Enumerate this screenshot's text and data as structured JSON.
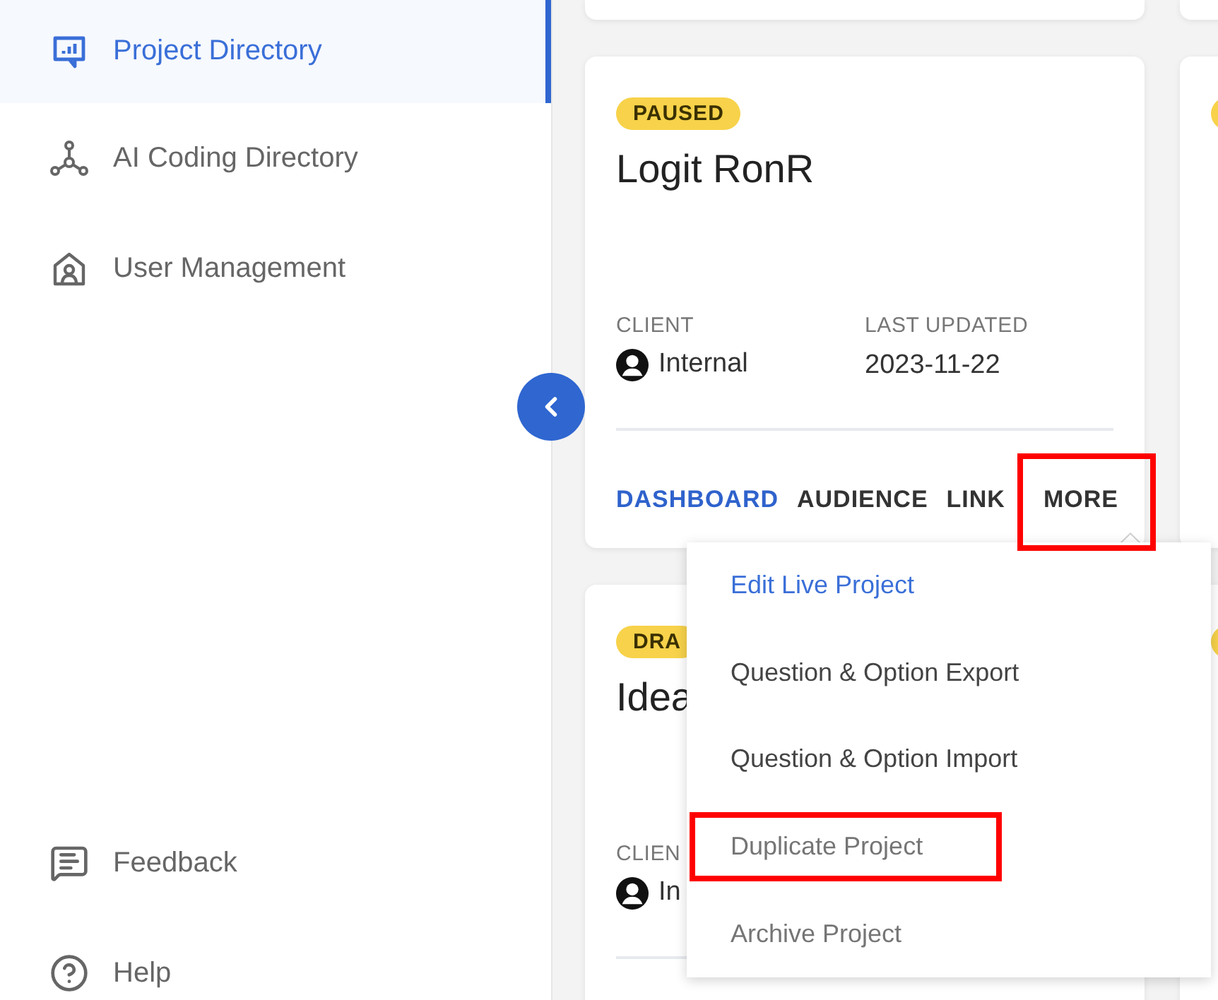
{
  "sidebar": {
    "items": [
      {
        "label": "Project Directory",
        "selected": true
      },
      {
        "label": "AI Coding Directory",
        "selected": false
      },
      {
        "label": "User Management",
        "selected": false
      }
    ],
    "footer_items": [
      {
        "label": "Feedback"
      },
      {
        "label": "Help"
      }
    ]
  },
  "cards": [
    {
      "status": "PAUSED",
      "title": "Logit RonR",
      "client_label": "CLIENT",
      "client": "Internal",
      "updated_label": "LAST UPDATED",
      "updated": "2023-11-22",
      "actions": [
        {
          "label": "DASHBOARD",
          "primary": true,
          "annotated": false
        },
        {
          "label": "AUDIENCE",
          "primary": false,
          "annotated": false
        },
        {
          "label": "LINK",
          "primary": false,
          "annotated": false
        },
        {
          "label": "MORE",
          "primary": false,
          "annotated": true
        }
      ]
    },
    {
      "status": "DRA",
      "title": "Idea",
      "client_label": "CLIEN",
      "client": "In"
    }
  ],
  "more_menu": {
    "items": [
      {
        "label": "Edit Live Project",
        "highlighted": true,
        "disabled": false,
        "annotated": false
      },
      {
        "label": "Question & Option Export",
        "highlighted": false,
        "disabled": false,
        "annotated": false
      },
      {
        "label": "Question & Option Import",
        "highlighted": false,
        "disabled": false,
        "annotated": false
      },
      {
        "label": "Duplicate Project",
        "highlighted": false,
        "disabled": true,
        "annotated": true
      },
      {
        "label": "Archive Project",
        "highlighted": false,
        "disabled": true,
        "annotated": false
      }
    ]
  }
}
